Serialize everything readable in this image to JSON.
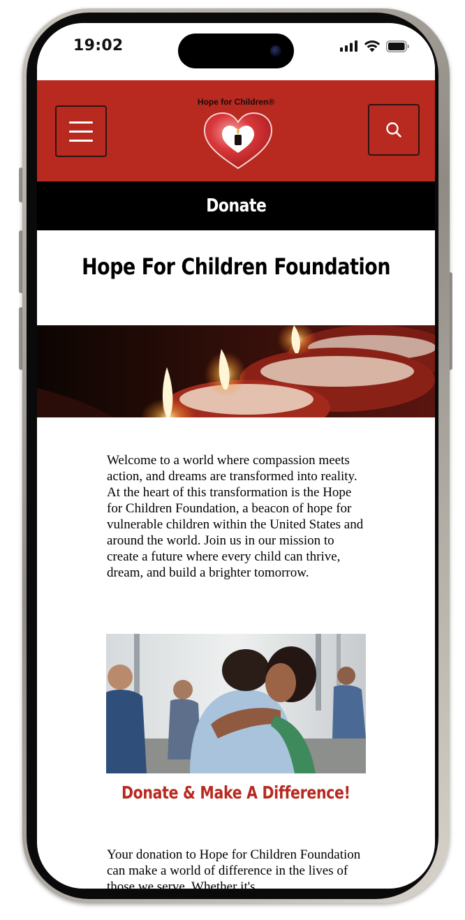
{
  "status_bar": {
    "time": "19:02"
  },
  "header": {
    "logo_text": "Hope for Children®",
    "menu_icon": "hamburger-menu-icon",
    "search_icon": "search-icon",
    "brand_color": "#b8291f"
  },
  "page": {
    "title": "Donate",
    "foundation_title": "Hope For Children Foundation",
    "intro": "Welcome to a world where compassion meets action, and dreams are transformed into reality. At the heart of this transformation is the Hope for Children Foundation, a beacon of hope for vulnerable children within the United States and around the world. Join us in our mission to create a future where every child can thrive, dream, and build a brighter tomorrow.",
    "donate_heading": "Donate & Make A Difference!",
    "donation_text": "Your donation to Hope for Children Foundation can make a world of difference in the lives of those we serve. Whether it's"
  }
}
